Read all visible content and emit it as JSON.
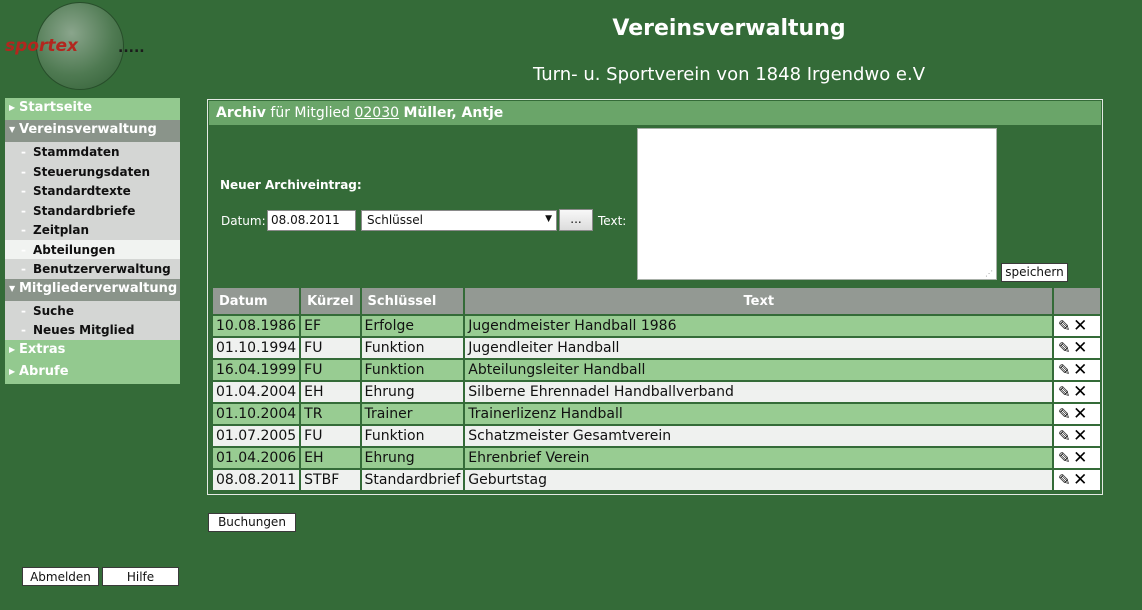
{
  "header": {
    "logo_text": "sportex",
    "logo_suffix": ".....",
    "app_title": "Vereinsverwaltung",
    "club_name": "Turn- u. Sportverein von 1848 Irgendwo e.V"
  },
  "sidebar": {
    "items": [
      {
        "label": "Startseite",
        "style": "light",
        "arrow": "right"
      },
      {
        "label": "Vereinsverwaltung",
        "style": "dark",
        "arrow": "down",
        "children": [
          "Stammdaten",
          "Steuerungsdaten",
          "Standardtexte",
          "Standardbriefe",
          "Zeitplan",
          "Abteilungen",
          "Benutzerverwaltung"
        ],
        "active_child": "Abteilungen"
      },
      {
        "label": "Mitgliederverwaltung",
        "style": "dark",
        "arrow": "down",
        "children": [
          "Suche",
          "Neues Mitglied"
        ]
      },
      {
        "label": "Extras",
        "style": "light",
        "arrow": "right"
      },
      {
        "label": "Abrufe",
        "style": "light",
        "arrow": "right"
      }
    ],
    "logout_label": "Abmelden",
    "help_label": "Hilfe"
  },
  "panel": {
    "title_prefix": "Archiv",
    "title_mid": "für Mitglied",
    "member_id": "02030",
    "member_name": "Müller, Antje",
    "new_entry_label": "Neuer Archiveintrag:",
    "date_label": "Datum:",
    "date_value": "08.08.2011",
    "key_select_value": "Schlüssel",
    "key_button_label": "...",
    "text_label": "Text:",
    "text_value": "",
    "save_label": "speichern"
  },
  "table": {
    "headers": [
      "Datum",
      "Kürzel",
      "Schlüssel",
      "Text",
      ""
    ],
    "rows": [
      {
        "date": "10.08.1986",
        "code": "EF",
        "key": "Erfolge",
        "text": "Jugendmeister Handball 1986"
      },
      {
        "date": "01.10.1994",
        "code": "FU",
        "key": "Funktion",
        "text": "Jugendleiter Handball"
      },
      {
        "date": "16.04.1999",
        "code": "FU",
        "key": "Funktion",
        "text": "Abteilungsleiter Handball"
      },
      {
        "date": "01.04.2004",
        "code": "EH",
        "key": "Ehrung",
        "text": "Silberne Ehrennadel Handballverband"
      },
      {
        "date": "01.10.2004",
        "code": "TR",
        "key": "Trainer",
        "text": "Trainerlizenz Handball"
      },
      {
        "date": "01.07.2005",
        "code": "FU",
        "key": "Funktion",
        "text": "Schatzmeister Gesamtverein"
      },
      {
        "date": "01.04.2006",
        "code": "EH",
        "key": "Ehrung",
        "text": "Ehrenbrief Verein"
      },
      {
        "date": "08.08.2011",
        "code": "STBF",
        "key": "Standardbrief",
        "text": "Geburtstag"
      }
    ],
    "edit_icon": "pencil-icon",
    "delete_icon": "x-icon"
  },
  "footer": {
    "bookings_label": "Buchungen"
  },
  "colors": {
    "background": "#346b38",
    "header_green": "#6aa569",
    "row_green": "#98cc92",
    "row_light": "#eff1ef",
    "nav_light": "#93c98f",
    "nav_dark": "#8a948a"
  }
}
